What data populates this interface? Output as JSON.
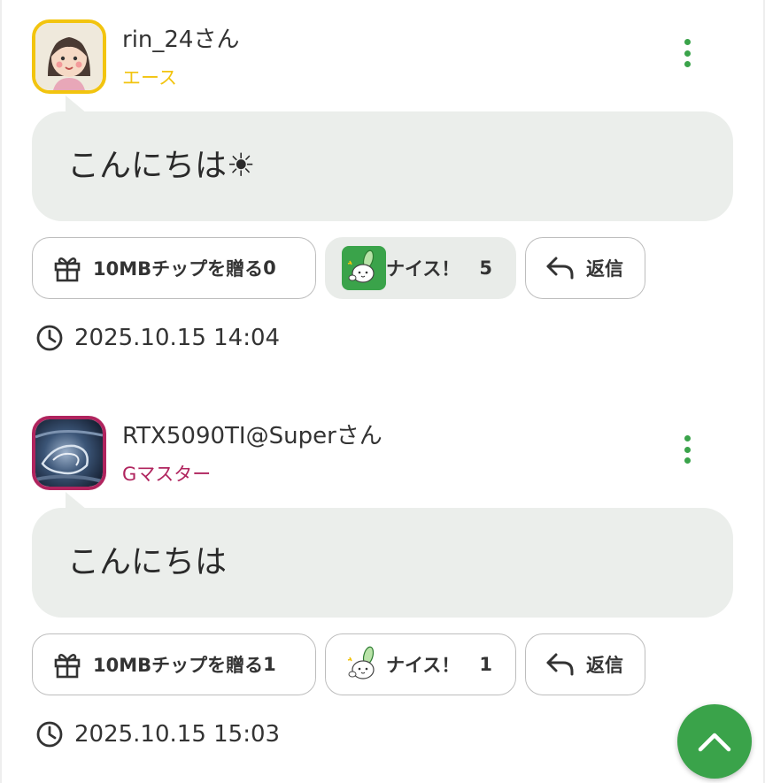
{
  "colors": {
    "accent": "#3aa34a",
    "rank_ace": "#f2c40f",
    "rank_gmaster": "#b0245e",
    "bubble_bg": "#ebeeeb"
  },
  "comments": [
    {
      "username": "rin_24さん",
      "rank": "エース",
      "rank_color": "#f2c40f",
      "avatar": "girl-avatar",
      "message": "こんにちは☀",
      "gift_label": "10MBチップを贈る",
      "gift_count": "0",
      "nice_label": "ナイス！",
      "nice_count": "5",
      "nice_active": true,
      "reply_label": "返信",
      "timestamp": "2025.10.15 14:04"
    },
    {
      "username": "RTX5090TI@Superさん",
      "rank": "Gマスター",
      "rank_color": "#b0245e",
      "avatar": "photo-avatar",
      "message": "こんにちは",
      "gift_label": "10MBチップを贈る",
      "gift_count": "1",
      "nice_label": "ナイス！",
      "nice_count": "1",
      "nice_active": false,
      "reply_label": "返信",
      "timestamp": "2025.10.15 15:03"
    }
  ],
  "icons": {
    "menu": "kebab-menu-icon",
    "gift": "gift-icon",
    "nice": "nice-rabbit-icon",
    "reply": "reply-arrow-icon",
    "clock": "clock-icon",
    "scroll_top": "chevron-up-icon"
  }
}
